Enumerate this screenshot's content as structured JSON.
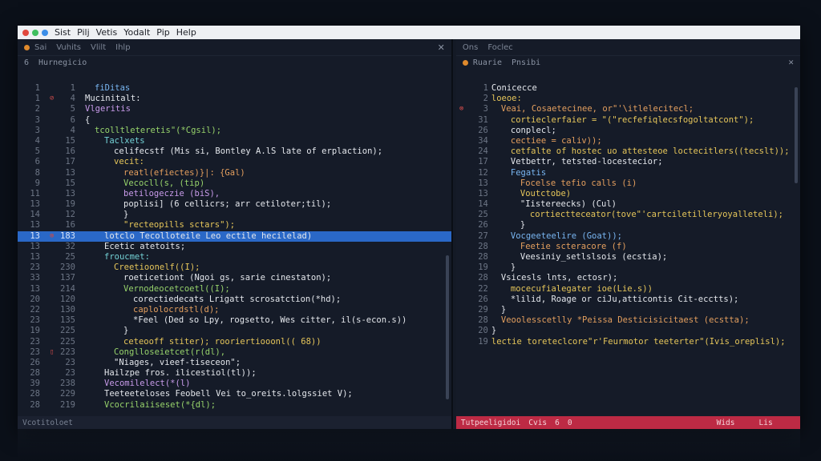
{
  "menu": {
    "items": [
      "Sist",
      "Pilj",
      "Vetis",
      "Yodalt",
      "Pip",
      "Help"
    ],
    "dot_colors": [
      "#e0483e",
      "#3fbf5f",
      "#3c8ee8"
    ]
  },
  "left_pane": {
    "header": [
      "Sai",
      "Vuhits",
      "Vlilt",
      "Ihlp"
    ],
    "tabs": [
      "6",
      "Hurnegicio"
    ],
    "lines": [
      {
        "n1": "1",
        "n2": "1",
        "g": "",
        "t": "fiDitas",
        "c": "c-blu",
        "i": 1
      },
      {
        "n1": "1",
        "n2": "4",
        "g": "⊘",
        "t": "Mucinitalt:",
        "c": "c-wht",
        "i": 0
      },
      {
        "n1": "2",
        "n2": "5",
        "g": "",
        "t": "Vlgeritis",
        "c": "c-pur",
        "i": 0
      },
      {
        "n1": "3",
        "n2": "6",
        "g": "",
        "t": "{",
        "c": "c-wht",
        "i": 0
      },
      {
        "n1": "3",
        "n2": "4",
        "g": "",
        "t": "tcolltleteretis\"(*Cgsil);",
        "c": "c-grn",
        "i": 1
      },
      {
        "n1": "4",
        "n2": "15",
        "g": "",
        "t": "Taclxets",
        "c": "c-cyn",
        "i": 2
      },
      {
        "n1": "5",
        "n2": "16",
        "g": "",
        "t": "celifecstf (Mis si, Bontley A.lS late of erplaction);",
        "c": "c-wht",
        "i": 3
      },
      {
        "n1": "6",
        "n2": "17",
        "g": "",
        "t": "vecit:",
        "c": "c-yel",
        "i": 3
      },
      {
        "n1": "8",
        "n2": "13",
        "g": "",
        "t": "reatl(efiectes)}|: {Gal)",
        "c": "c-org",
        "i": 4
      },
      {
        "n1": "9",
        "n2": "15",
        "g": "",
        "t": "Vecocll(s, (tip)",
        "c": "c-grn",
        "i": 4
      },
      {
        "n1": "11",
        "n2": "13",
        "g": "",
        "t": "betilogeczie (biS),",
        "c": "c-pur",
        "i": 4
      },
      {
        "n1": "13",
        "n2": "19",
        "g": "",
        "t": "poplisi] (6 cellicrs; arr cetiloter;til);",
        "c": "c-wht",
        "i": 4
      },
      {
        "n1": "14",
        "n2": "12",
        "g": "",
        "t": "}",
        "c": "c-wht",
        "i": 4
      },
      {
        "n1": "13",
        "n2": "16",
        "g": "",
        "t": "\"recteopills sctars\");",
        "c": "c-yel",
        "i": 4
      },
      {
        "n1": "13",
        "n2": "183",
        "g": "⊗",
        "t": "lotclo Tecolloteile Leo ectile hecilelad)",
        "c": "c-wht",
        "i": 2,
        "hl": true
      },
      {
        "n1": "13",
        "n2": "32",
        "g": "",
        "t": "Ecetic atetoits;",
        "c": "c-wht",
        "i": 2
      },
      {
        "n1": "13",
        "n2": "25",
        "g": "",
        "t": "froucmet:",
        "c": "c-cyn",
        "i": 2
      },
      {
        "n1": "23",
        "n2": "230",
        "g": "",
        "t": "Creetioonelf((I);",
        "c": "c-yel",
        "i": 3
      },
      {
        "n1": "33",
        "n2": "137",
        "g": "",
        "t": "roeticetiont (Ngoi gs, sarie cinestaton);",
        "c": "c-wht",
        "i": 4
      },
      {
        "n1": "13",
        "n2": "214",
        "g": "",
        "t": "Vernodeocetcoetl((I);",
        "c": "c-grn",
        "i": 4
      },
      {
        "n1": "20",
        "n2": "120",
        "g": "",
        "t": "corectiedecats Lrigatt scrosatction(*hd);",
        "c": "c-wht",
        "i": 5
      },
      {
        "n1": "22",
        "n2": "130",
        "g": "",
        "t": "caplolocrdstl(d);",
        "c": "c-org",
        "i": 5
      },
      {
        "n1": "23",
        "n2": "135",
        "g": "",
        "t": "*Feel (Ded so Lpy, rogsetto, Wes citter, il(s-econ.s))",
        "c": "c-wht",
        "i": 5
      },
      {
        "n1": "19",
        "n2": "225",
        "g": "",
        "t": "}",
        "c": "c-wht",
        "i": 4
      },
      {
        "n1": "23",
        "n2": "225",
        "g": "",
        "t": "ceteooff stiter); rooriertiooonl(( 68))",
        "c": "c-yel",
        "i": 4
      },
      {
        "n1": "23",
        "n2": "223",
        "g": "▯",
        "t": "Conglloseietcet(r(dl),",
        "c": "c-grn",
        "i": 3
      },
      {
        "n1": "26",
        "n2": "23",
        "g": "",
        "t": "\"Niages, vieef-tiseceon\";",
        "c": "c-wht",
        "i": 3
      },
      {
        "n1": "28",
        "n2": "23",
        "g": "",
        "t": "Hailzpe fros. ilicestiol(tl));",
        "c": "c-wht",
        "i": 2
      },
      {
        "n1": "39",
        "n2": "238",
        "g": "",
        "t": "Vecomilelect(*(l)",
        "c": "c-pur",
        "i": 2
      },
      {
        "n1": "28",
        "n2": "229",
        "g": "",
        "t": "Teeteeteloses Feobell Vei to_oreits.lolgssiet V);",
        "c": "c-wht",
        "i": 2
      },
      {
        "n1": "28",
        "n2": "219",
        "g": "",
        "t": "Vcocrilaiiseset(*{dl);",
        "c": "c-grn",
        "i": 2
      }
    ],
    "status": [
      "Vcotitoloet",
      ""
    ]
  },
  "right_pane": {
    "header": [
      "Ons",
      "Foclec"
    ],
    "tabs": [
      "Ruarie",
      "Pnsibi"
    ],
    "lines": [
      {
        "n1": "1",
        "g": "",
        "t": "Conicecce",
        "c": "c-wht",
        "i": 0
      },
      {
        "n1": "2",
        "g": "",
        "t": "loeoe:",
        "c": "c-yel",
        "i": 0
      },
      {
        "n1": "3",
        "g": "⊗",
        "t": "Veai, Cosaetecinee, or\"'\\itlelecitecl;",
        "c": "c-org",
        "i": 1
      },
      {
        "n1": "31",
        "g": "",
        "t": "cortieclerfaier = \"(\"recfefiqlecsfogoltatcont\");",
        "c": "c-yel",
        "i": 2
      },
      {
        "n1": "26",
        "g": "",
        "t": "conplecl;",
        "c": "c-wht",
        "i": 2
      },
      {
        "n1": "34",
        "g": "",
        "t": "cectiee = caliv));",
        "c": "c-org",
        "i": 2
      },
      {
        "n1": "24",
        "g": "",
        "t": "cetfalte of hostec uo attesteoe loctecitlers((tecslt));",
        "c": "c-yel",
        "i": 2
      },
      {
        "n1": "17",
        "g": "",
        "t": "Vetbettr, tetsted-locestecior;",
        "c": "c-wht",
        "i": 2
      },
      {
        "n1": "12",
        "g": "",
        "t": "Fegatis",
        "c": "c-blu",
        "i": 2
      },
      {
        "n1": "13",
        "g": "",
        "t": "Focelse tefio calls (i)",
        "c": "c-org",
        "i": 3
      },
      {
        "n1": "13",
        "g": "",
        "t": "Voutctobe)",
        "c": "c-yel",
        "i": 3
      },
      {
        "n1": "14",
        "g": "",
        "t": "\"Iistereecks) (Cul)",
        "c": "c-wht",
        "i": 3
      },
      {
        "n1": "25",
        "g": "",
        "t": "cortiectteceator(tove\"'cartciletilleryoyalleteli);",
        "c": "c-yel",
        "i": 4
      },
      {
        "n1": "26",
        "g": "",
        "t": "}",
        "c": "c-wht",
        "i": 3
      },
      {
        "n1": "27",
        "g": "",
        "t": "Vocgeeteelire (Goat));",
        "c": "c-blu",
        "i": 2
      },
      {
        "n1": "28",
        "g": "",
        "t": "Feetie scteracore (f)",
        "c": "c-org",
        "i": 3
      },
      {
        "n1": "28",
        "g": "",
        "t": "Veesiniy_setlslsois (ecstia);",
        "c": "c-wht",
        "i": 3
      },
      {
        "n1": "19",
        "g": "",
        "t": "}",
        "c": "c-wht",
        "i": 2
      },
      {
        "n1": "28",
        "g": "",
        "t": "Vsicesls lnts, ectosr);",
        "c": "c-wht",
        "i": 1
      },
      {
        "n1": "22",
        "g": "",
        "t": "mocecufialegater ioe(Lie.s))",
        "c": "c-yel",
        "i": 2
      },
      {
        "n1": "26",
        "g": "",
        "t": "*lilid, Roage or ciJu,atticontis Cit-ecctts);",
        "c": "c-wht",
        "i": 2
      },
      {
        "n1": "29",
        "g": "",
        "t": "}",
        "c": "c-wht",
        "i": 1
      },
      {
        "n1": "28",
        "g": "",
        "t": "Veoolesscetlly *Peissa Desticisicitaest (ecstta);",
        "c": "c-org",
        "i": 1
      },
      {
        "n1": "20",
        "g": "",
        "t": "}",
        "c": "c-wht",
        "i": 0
      },
      {
        "n1": "19",
        "g": "",
        "t": "lectie toreteclcore\"r'Feurmotor teeterter\"(Ivis_oreplisl);",
        "c": "c-yel",
        "i": 0
      }
    ],
    "status": [
      "Tutpeeligidoi",
      "Cvis",
      "6",
      "0",
      "",
      "Wids",
      "Lis"
    ]
  }
}
